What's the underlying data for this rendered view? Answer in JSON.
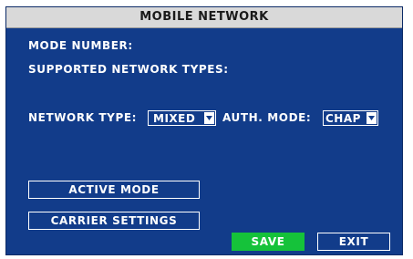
{
  "window": {
    "title": "MOBILE NETWORK"
  },
  "info": {
    "mode_number_label": "MODE NUMBER:",
    "supported_types_label": "SUPPORTED NETWORK TYPES:"
  },
  "network": {
    "network_type_label": "NETWORK TYPE:",
    "network_type_value": "MIXED",
    "auth_mode_label": "AUTH. MODE:",
    "auth_mode_value": "CHAP"
  },
  "buttons": {
    "active_mode": "ACTIVE MODE",
    "carrier_settings": "CARRIER SETTINGS",
    "save": "SAVE",
    "exit": "EXIT"
  },
  "colors": {
    "background": "#123c8a",
    "titlebar": "#d9d9d9",
    "save_button": "#15c23a",
    "text": "#ffffff"
  },
  "icons": {
    "dropdown": "chevron-down-icon"
  }
}
